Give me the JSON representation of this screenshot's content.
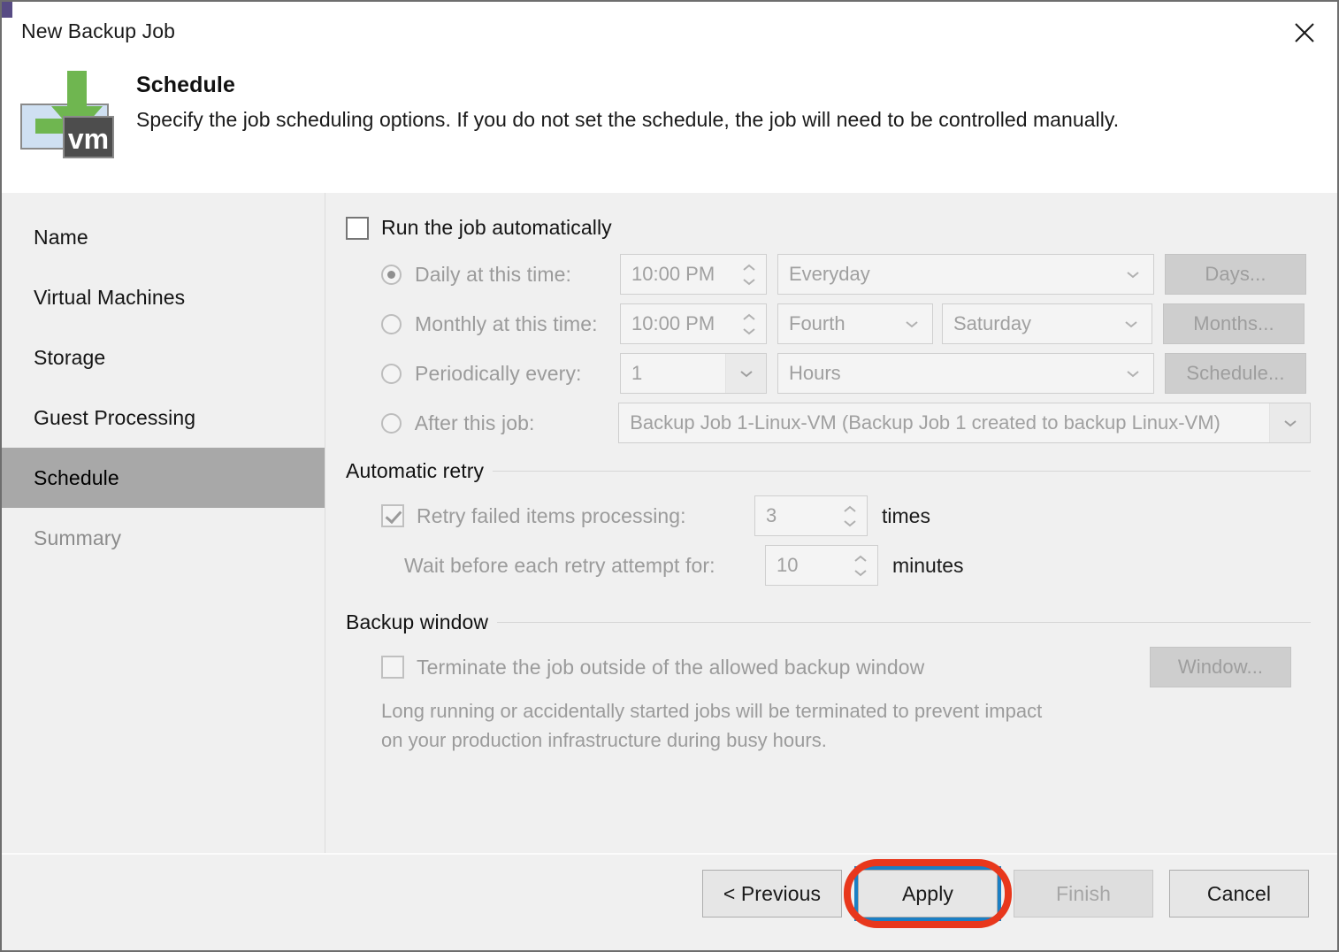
{
  "window": {
    "title": "New Backup Job",
    "close_icon": "close-icon"
  },
  "header": {
    "icon": "backup-vm-icon",
    "title": "Schedule",
    "subtitle": "Specify the job scheduling options. If you do not set the schedule, the job will need to be controlled manually."
  },
  "sidebar": {
    "items": [
      {
        "label": "Name",
        "state": "normal"
      },
      {
        "label": "Virtual Machines",
        "state": "normal"
      },
      {
        "label": "Storage",
        "state": "normal"
      },
      {
        "label": "Guest Processing",
        "state": "normal"
      },
      {
        "label": "Schedule",
        "state": "active"
      },
      {
        "label": "Summary",
        "state": "dim"
      }
    ]
  },
  "schedule": {
    "run_automatically": {
      "label": "Run the job automatically",
      "checked": false
    },
    "options": [
      {
        "label": "Daily at this time:",
        "selected": true,
        "time": "10:00 PM",
        "dropdown": "Everyday",
        "button": "Days..."
      },
      {
        "label": "Monthly at this time:",
        "selected": false,
        "time": "10:00 PM",
        "dropdown_ordinal": "Fourth",
        "dropdown_day": "Saturday",
        "button": "Months..."
      },
      {
        "label": "Periodically every:",
        "selected": false,
        "interval": "1",
        "dropdown_unit": "Hours",
        "button": "Schedule..."
      },
      {
        "label": "After this job:",
        "selected": false,
        "dropdown_job": "Backup Job 1-Linux-VM (Backup Job 1 created to backup Linux-VM)"
      }
    ]
  },
  "automatic_retry": {
    "group_title": "Automatic retry",
    "retry_checkbox_label": "Retry failed items processing:",
    "retry_checked": true,
    "retry_times_value": "3",
    "retry_times_unit": "times",
    "wait_label": "Wait before each retry attempt for:",
    "wait_value": "10",
    "wait_unit": "minutes"
  },
  "backup_window": {
    "group_title": "Backup window",
    "terminate_label": "Terminate the job outside of the allowed backup window",
    "terminate_checked": false,
    "window_button": "Window...",
    "note_line1": "Long running or accidentally started jobs will be terminated to prevent impact",
    "note_line2": "on your production infrastructure during busy hours."
  },
  "footer": {
    "previous": "< Previous",
    "apply": "Apply",
    "finish": "Finish",
    "cancel": "Cancel"
  },
  "colors": {
    "accent_focus": "#1b7fc4",
    "annotation": "#e8371c",
    "active_nav": "#a8a8a8",
    "icon_green": "#6fb650"
  }
}
